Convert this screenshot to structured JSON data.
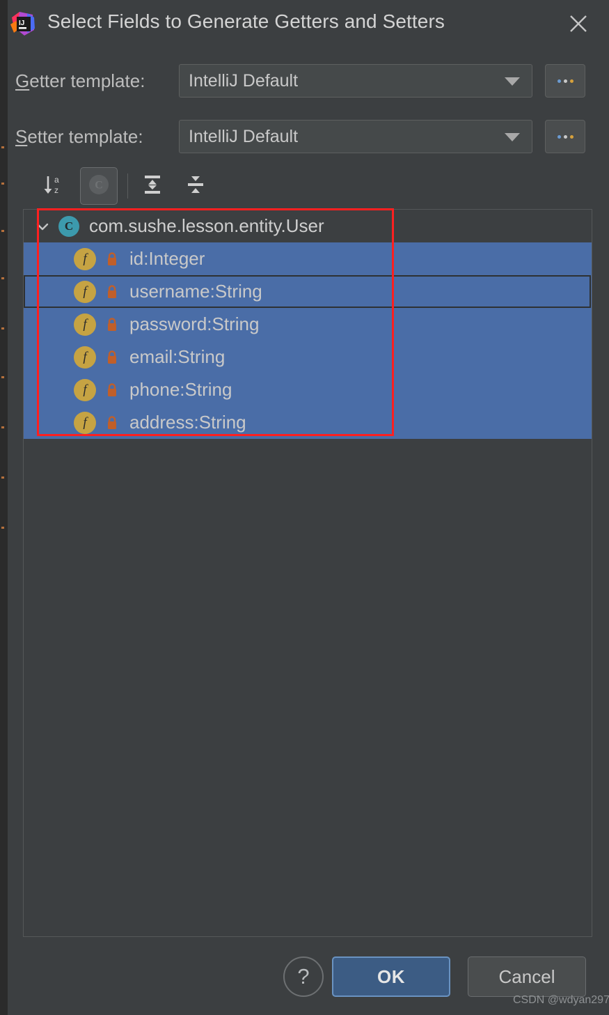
{
  "window": {
    "title": "Select Fields to Generate Getters and Setters",
    "logo_icon": "intellij-idea-logo",
    "close_icon": "close-icon"
  },
  "form": {
    "getter": {
      "label_prefix": "",
      "label_mnemonic": "G",
      "label_rest": "etter template:",
      "value": "IntelliJ Default",
      "arrow_icon": "chevron-down-icon",
      "browse_label": "..."
    },
    "setter": {
      "label_mnemonic": "S",
      "label_rest": "etter template:",
      "value": "IntelliJ Default",
      "arrow_icon": "chevron-down-icon",
      "browse_label": "..."
    }
  },
  "toolbar": {
    "buttons": [
      {
        "name": "sort-alphabetically-button",
        "icon": "sort-az-icon",
        "tooltip": "Sort alphabetically",
        "selected": false
      },
      {
        "name": "group-by-class-button",
        "icon": "class-circle-icon",
        "tooltip": "Group by class",
        "selected": true
      },
      {
        "name": "expand-all-button",
        "icon": "expand-all-icon",
        "tooltip": "Expand All",
        "selected": false
      },
      {
        "name": "collapse-all-button",
        "icon": "collapse-all-icon",
        "tooltip": "Collapse All",
        "selected": false
      }
    ]
  },
  "tree": {
    "class_node": {
      "label": "com.sushe.lesson.entity.User",
      "icon": "class-icon",
      "icon_letter": "C",
      "chevron": "chevron-down-icon",
      "expanded": true
    },
    "fields": [
      {
        "label": "id:Integer",
        "icon": "field-icon",
        "icon_letter": "f",
        "visibility_icon": "lock-private-icon",
        "selected": true,
        "focused": false
      },
      {
        "label": "username:String",
        "icon": "field-icon",
        "icon_letter": "f",
        "visibility_icon": "lock-private-icon",
        "selected": true,
        "focused": true
      },
      {
        "label": "password:String",
        "icon": "field-icon",
        "icon_letter": "f",
        "visibility_icon": "lock-private-icon",
        "selected": true,
        "focused": false
      },
      {
        "label": "email:String",
        "icon": "field-icon",
        "icon_letter": "f",
        "visibility_icon": "lock-private-icon",
        "selected": true,
        "focused": false
      },
      {
        "label": "phone:String",
        "icon": "field-icon",
        "icon_letter": "f",
        "visibility_icon": "lock-private-icon",
        "selected": true,
        "focused": false
      },
      {
        "label": "address:String",
        "icon": "field-icon",
        "icon_letter": "f",
        "visibility_icon": "lock-private-icon",
        "selected": true,
        "focused": false
      }
    ]
  },
  "footer": {
    "help_label": "?",
    "ok_label": "OK",
    "cancel_label": "Cancel"
  },
  "watermark": "CSDN @wdyan297",
  "colors": {
    "dialog_background": "#3c3f41",
    "selection_blue": "#4a6da7",
    "accent_ok": "#3c5c84",
    "class_icon": "#3c9aad",
    "field_icon": "#c6a343",
    "lock_icon": "#c05f2a",
    "annotation_red": "#ff2020",
    "text_primary": "#c9c9c9"
  }
}
